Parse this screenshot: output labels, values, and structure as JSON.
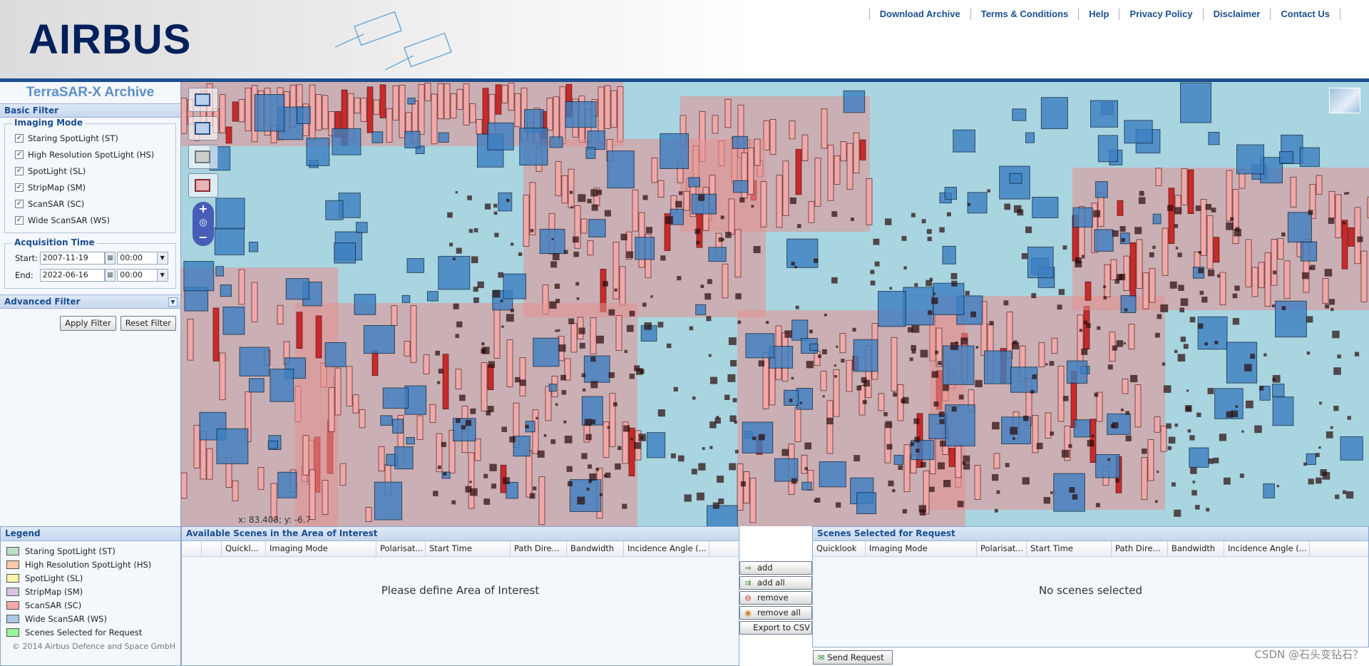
{
  "header": {
    "logo": "AIRBUS",
    "links": [
      "Download Archive",
      "Terms & Conditions",
      "Help",
      "Privacy Policy",
      "Disclaimer",
      "Contact Us"
    ]
  },
  "sidebar": {
    "title": "TerraSAR-X Archive",
    "basic_filter": "Basic Filter",
    "imaging_mode": {
      "title": "Imaging Mode",
      "items": [
        {
          "label": "Staring SpotLight (ST)",
          "checked": true
        },
        {
          "label": "High Resolution SpotLight (HS)",
          "checked": true
        },
        {
          "label": "SpotLight (SL)",
          "checked": true
        },
        {
          "label": "StripMap (SM)",
          "checked": true
        },
        {
          "label": "ScanSAR (SC)",
          "checked": true
        },
        {
          "label": "Wide ScanSAR (WS)",
          "checked": true
        }
      ]
    },
    "acquisition_time": {
      "title": "Acquisition Time",
      "start_label": "Start:",
      "start_date": "2007-11-19",
      "start_time": "00:00",
      "end_label": "End:",
      "end_date": "2022-06-16",
      "end_time": "00:00"
    },
    "advanced_filter": "Advanced Filter",
    "apply_label": "Apply Filter",
    "reset_label": "Reset Filter"
  },
  "map": {
    "coords": "x: 83.408; y: -6.7"
  },
  "legend": {
    "title": "Legend",
    "items": [
      {
        "label": "Staring SpotLight (ST)",
        "color": "#b9e0c4"
      },
      {
        "label": "High Resolution SpotLight (HS)",
        "color": "#f9c9a9"
      },
      {
        "label": "SpotLight (SL)",
        "color": "#fbf5a8"
      },
      {
        "label": "StripMap (SM)",
        "color": "#d6c3e3"
      },
      {
        "label": "ScanSAR (SC)",
        "color": "#f2a9a9"
      },
      {
        "label": "Wide ScanSAR (WS)",
        "color": "#aac8e8"
      },
      {
        "label": "Scenes Selected for Request",
        "color": "#98f598"
      }
    ],
    "copyright": "© 2014 Airbus Defence and Space GmbH"
  },
  "available": {
    "title": "Available Scenes in the Area of Interest",
    "columns": [
      "",
      "",
      "Quickl...",
      "Imaging Mode",
      "Polarisat...",
      "Start Time",
      "Path Dire...",
      "Bandwidth",
      "Incidence Angle (..."
    ],
    "empty": "Please define Area of Interest"
  },
  "actions": {
    "add": "add",
    "add_all": "add all",
    "remove": "remove",
    "remove_all": "remove all",
    "export": "Export to CSV"
  },
  "selected": {
    "title": "Scenes Selected for Request",
    "columns": [
      "Quicklook",
      "Imaging Mode",
      "Polarisat...",
      "Start Time",
      "Path Dire...",
      "Bandwidth",
      "Incidence Angle (..."
    ],
    "empty": "No scenes selected",
    "send": "Send Request"
  },
  "watermark": "CSDN @石头变钻石？"
}
